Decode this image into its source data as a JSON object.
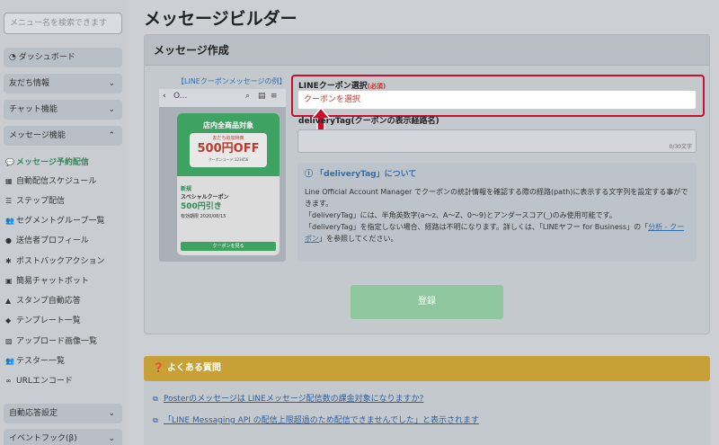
{
  "sidebar": {
    "search_placeholder": "メニュー名を検索できます",
    "dashboard": "ダッシュボード",
    "groups": [
      {
        "label": "友だち情報",
        "chevron": "⌄"
      },
      {
        "label": "チャット機能",
        "chevron": "⌄"
      },
      {
        "label": "メッセージ機能",
        "chevron": "⌃"
      }
    ],
    "items": [
      {
        "label": "メッセージ予約配信",
        "icon": "💬"
      },
      {
        "label": "自動配信スケジュール",
        "icon": "▦"
      },
      {
        "label": "ステップ配信",
        "icon": "☰"
      },
      {
        "label": "セグメントグループ一覧",
        "icon": "👥"
      },
      {
        "label": "送信者プロフィール",
        "icon": "●"
      },
      {
        "label": "ポストバックアクション",
        "icon": "✱"
      },
      {
        "label": "簡易チャットボット",
        "icon": "▣"
      },
      {
        "label": "スタンプ自動応答",
        "icon": "▲"
      },
      {
        "label": "テンプレート一覧",
        "icon": "◆"
      },
      {
        "label": "アップロード画像一覧",
        "icon": "▨"
      },
      {
        "label": "テスター一覧",
        "icon": "👥"
      },
      {
        "label": "URLエンコード",
        "icon": "∞"
      }
    ],
    "bottom_groups": [
      {
        "label": "自動応答設定",
        "chevron": "⌄"
      },
      {
        "label": "イベントフック(β)",
        "chevron": "⌄"
      }
    ]
  },
  "main": {
    "page_title": "メッセージビルダー",
    "card_title": "メッセージ作成",
    "example_title": "【LINEクーポンメッセージの例】",
    "phone": {
      "back": "‹",
      "name": "O...",
      "icons": [
        "⌕",
        "▤",
        "≡"
      ]
    },
    "coupon": {
      "head": "店内全商品対象",
      "sub": "友だち追加特典",
      "big": "500円OFF",
      "code": "クーポンコード:123456",
      "tag": "新規",
      "name": "スペシャルクーポン",
      "value": "500円引き",
      "valid": "有効期限 2020/08/15",
      "button": "クーポンを見る"
    },
    "coupon_label": "LINEクーポン選択",
    "required": "(必須)",
    "coupon_select": "クーポンを選択",
    "dtag_label": "deliveryTag(クーポンの表示経路名)",
    "dtag_count": "0/30文字",
    "info_title": "「deliveryTag」について",
    "info_line1": "Line Official Account Manager でクーポンの統計情報を確認する際の経路(path)に表示する文字列を設定する事ができます。",
    "info_line2": "「deliveryTag」には、半角英数字(a〜z、A〜Z、0〜9)とアンダースコア(_)のみ使用可能です。",
    "info_line3_a": "「deliveryTag」を指定しない場合、経路は不明になります。詳しくは、「LINEヤフー for Business」の「",
    "info_link": "分析 - クーポン",
    "info_line3_b": "」を参照してください。",
    "register": "登録"
  },
  "faq": {
    "title": "よくある質問",
    "items": [
      "Posterのメッセージは LINEメッセージ配信数の課金対象になりますか?",
      "「LINE Messaging API の配信上限超過のため配信できませんでした」と表示されます"
    ]
  }
}
